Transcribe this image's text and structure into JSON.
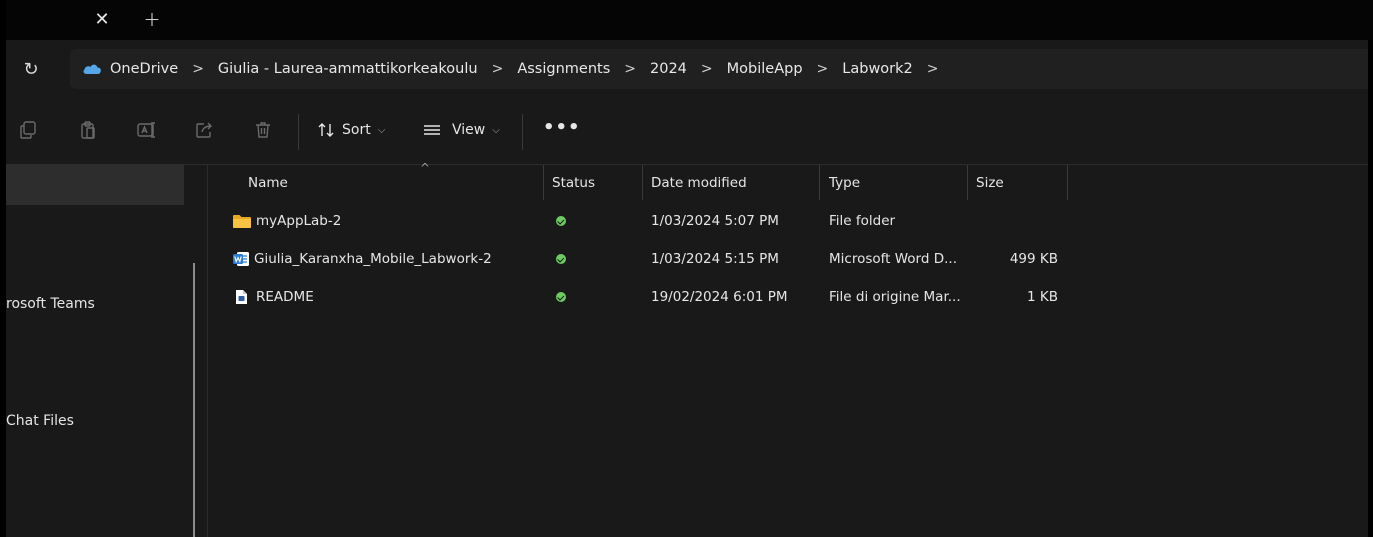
{
  "window": {
    "tab_close_icon": "close-icon",
    "tab_new_icon": "plus-icon"
  },
  "address": {
    "refresh_icon": "refresh-icon",
    "breadcrumbs": [
      "OneDrive",
      "Giulia - Laurea-ammattikorkeakoulu",
      "Assignments",
      "2024",
      "MobileApp",
      "Labwork2"
    ],
    "separator": ">"
  },
  "toolbar": {
    "sort_label": "Sort",
    "view_label": "View",
    "more_label": "•••",
    "icons": [
      "copy-icon",
      "paste-icon",
      "rename-icon",
      "share-icon",
      "delete-icon"
    ]
  },
  "nav": {
    "items": [
      "rosoft Teams",
      "Chat Files"
    ]
  },
  "columns": {
    "name": "Name",
    "status": "Status",
    "date": "Date modified",
    "type": "Type",
    "size": "Size"
  },
  "files": [
    {
      "name": "myAppLab-2",
      "icon": "folder-icon",
      "status": "synced",
      "date": "1/03/2024 5:07 PM",
      "type": "File folder",
      "size": ""
    },
    {
      "name": "Giulia_Karanxha_Mobile_Labwork-2",
      "icon": "word-document-icon",
      "status": "synced",
      "date": "1/03/2024 5:15 PM",
      "type": "Microsoft Word D...",
      "size": "499 KB"
    },
    {
      "name": "README",
      "icon": "markdown-file-icon",
      "status": "synced",
      "date": "19/02/2024 6:01 PM",
      "type": "File di origine Mar...",
      "size": "1 KB"
    }
  ],
  "colors": {
    "background": "#191919",
    "folder": "#f6c343",
    "word": "#2b7cd3",
    "status_ok": "#6ccb5f",
    "onedrive": "#56a6ea"
  }
}
